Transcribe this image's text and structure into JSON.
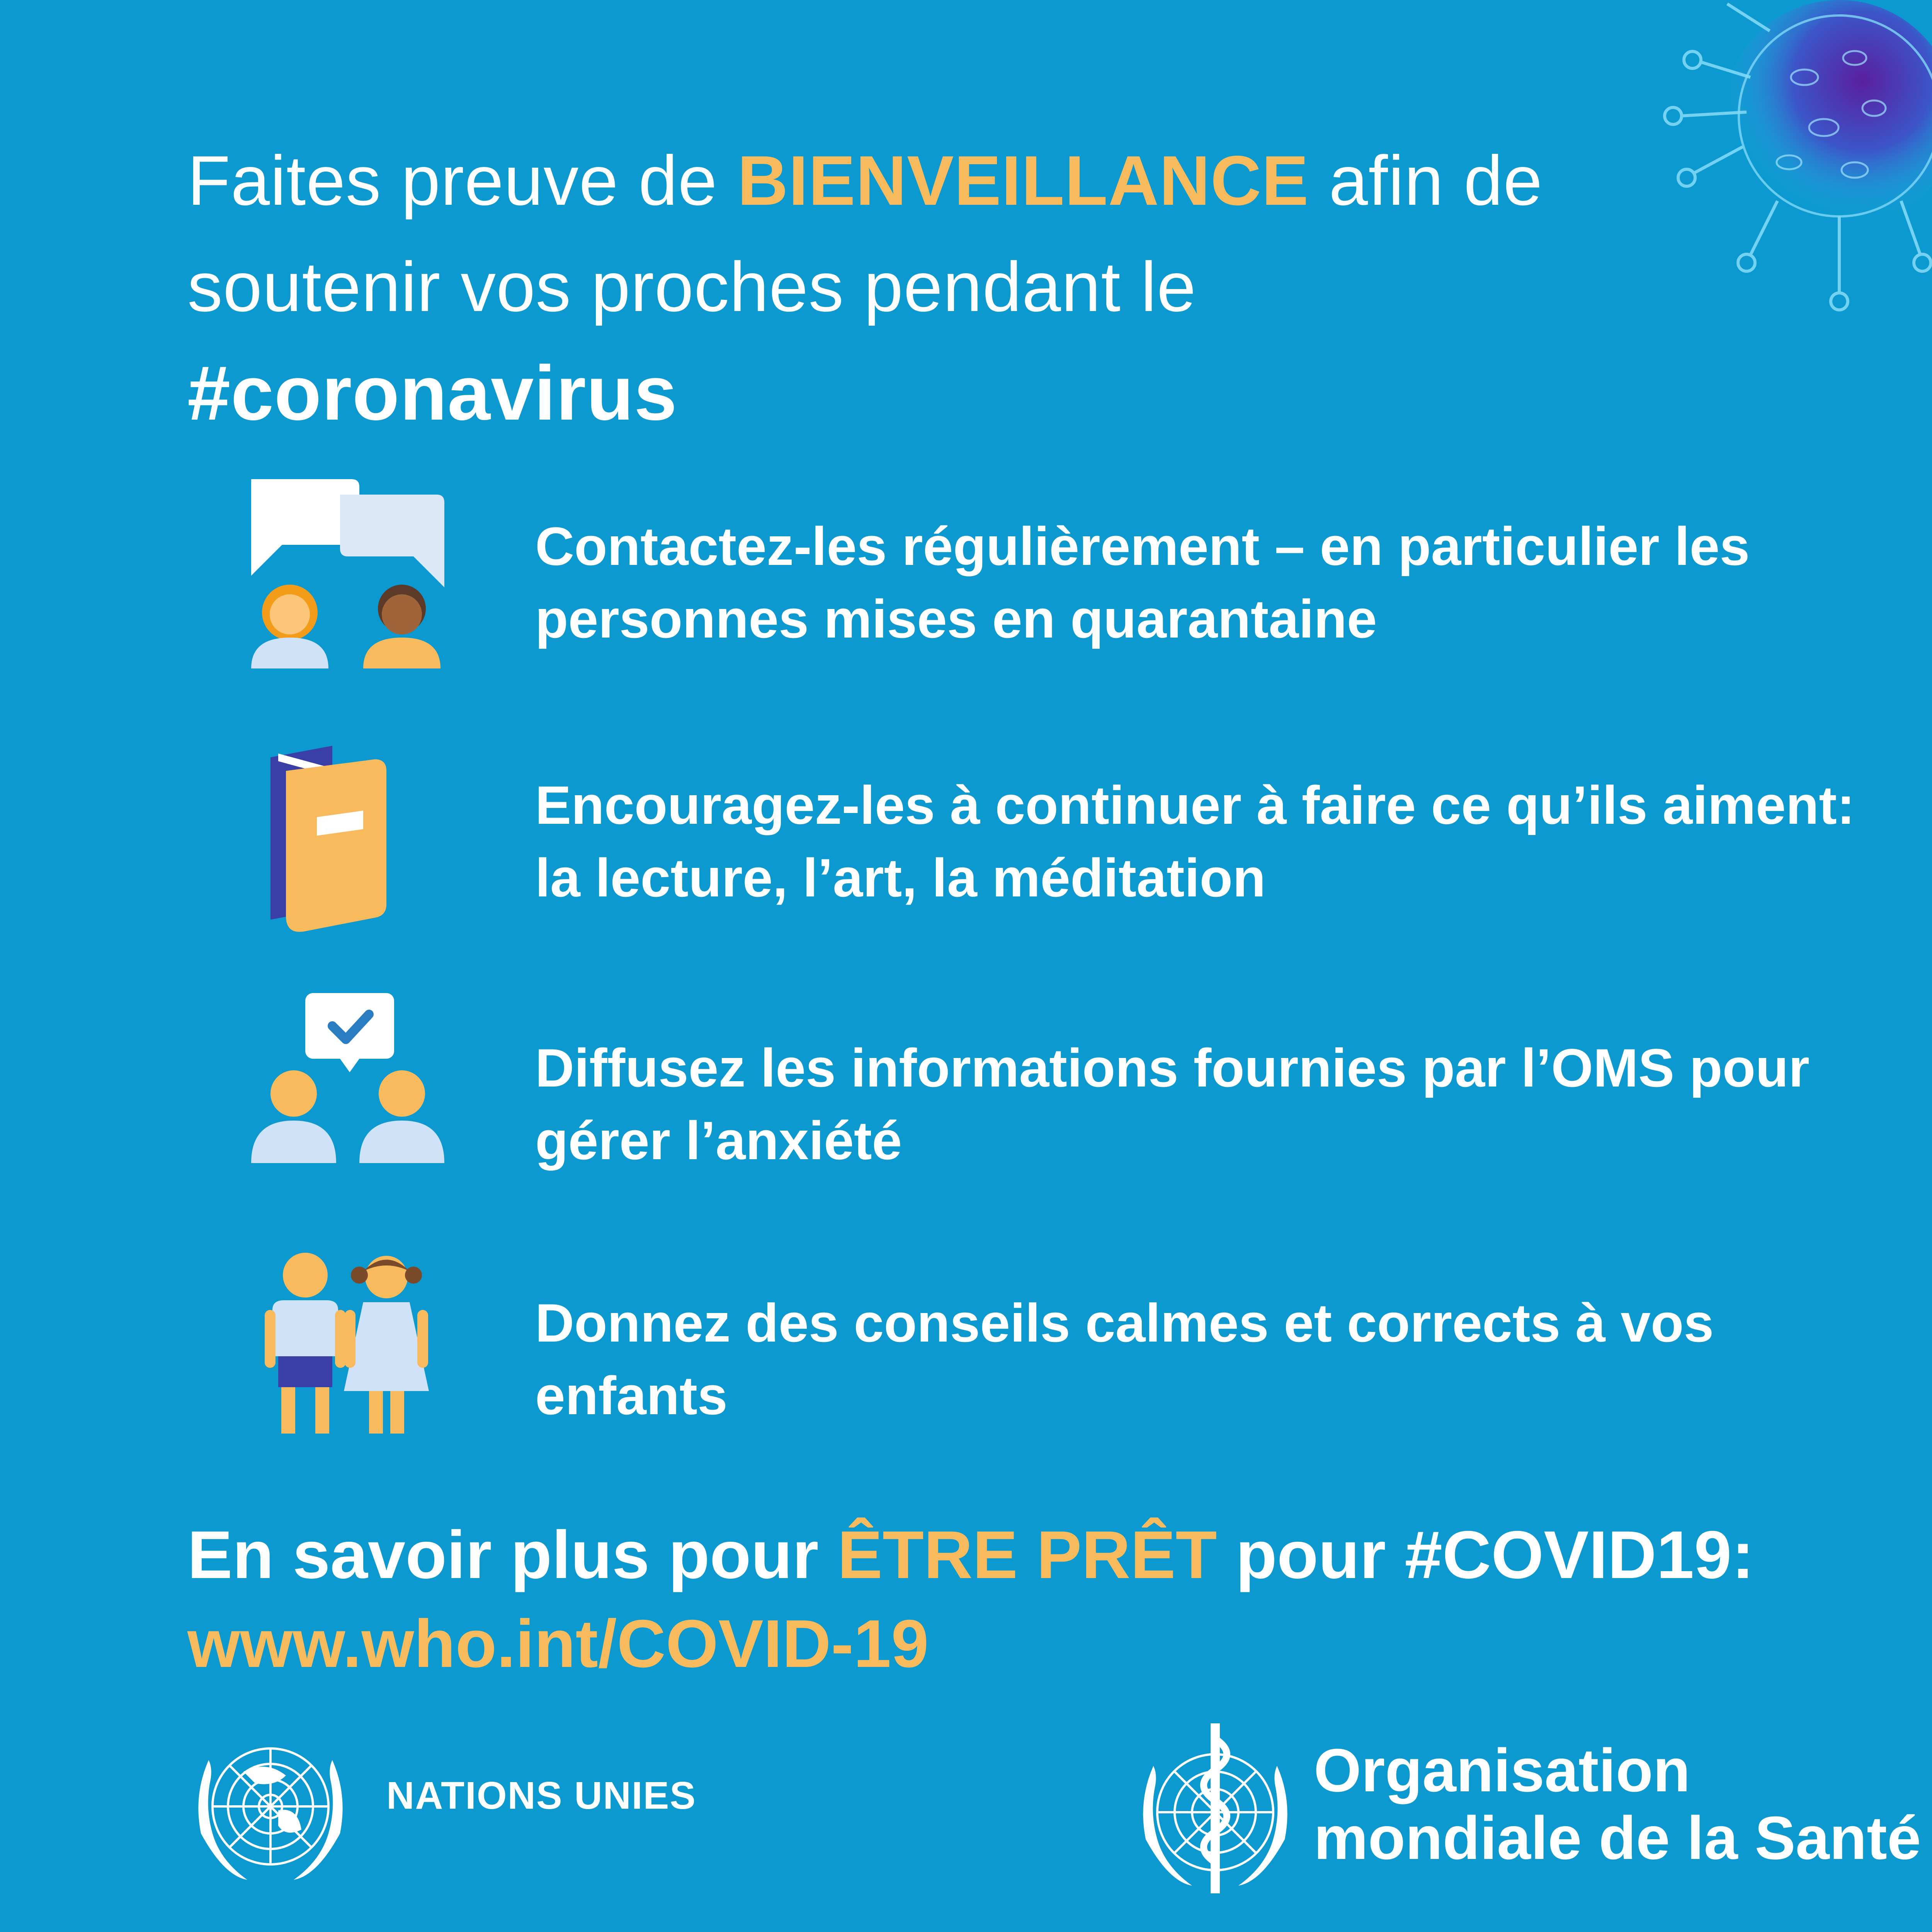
{
  "headline": {
    "part1": "Faites preuve de ",
    "accent": "BIENVEILLANCE",
    "part2": " afin de soutenir vos proches pendant le",
    "hashtag": "#coronavirus"
  },
  "items": [
    {
      "text": "Contactez-les régulièrement – en particulier les personnes mises en quarantaine",
      "icon": "chat-people-icon"
    },
    {
      "text": "Encouragez-les à continuer à faire ce qu’ils aiment: la lecture, l’art, la méditation",
      "icon": "books-icon"
    },
    {
      "text": "Diffusez les informations fournies par l’OMS pour gérer l’anxiété",
      "icon": "share-info-icon"
    },
    {
      "text": "Donnez des conseils calmes et corrects à vos enfants",
      "icon": "children-icon"
    }
  ],
  "cta": {
    "part1": "En savoir plus pour ",
    "accent": "ÊTRE PRÊT",
    "part2": " pour #COVID19:",
    "url": "www.who.int/COVID-19"
  },
  "footer": {
    "un_label": "NATIONS UNIES",
    "who_line1": "Organisation",
    "who_line2": "mondiale de la Santé"
  },
  "colors": {
    "background": "#0b99cf",
    "accent": "#f7bb5e",
    "text": "#ffffff"
  }
}
